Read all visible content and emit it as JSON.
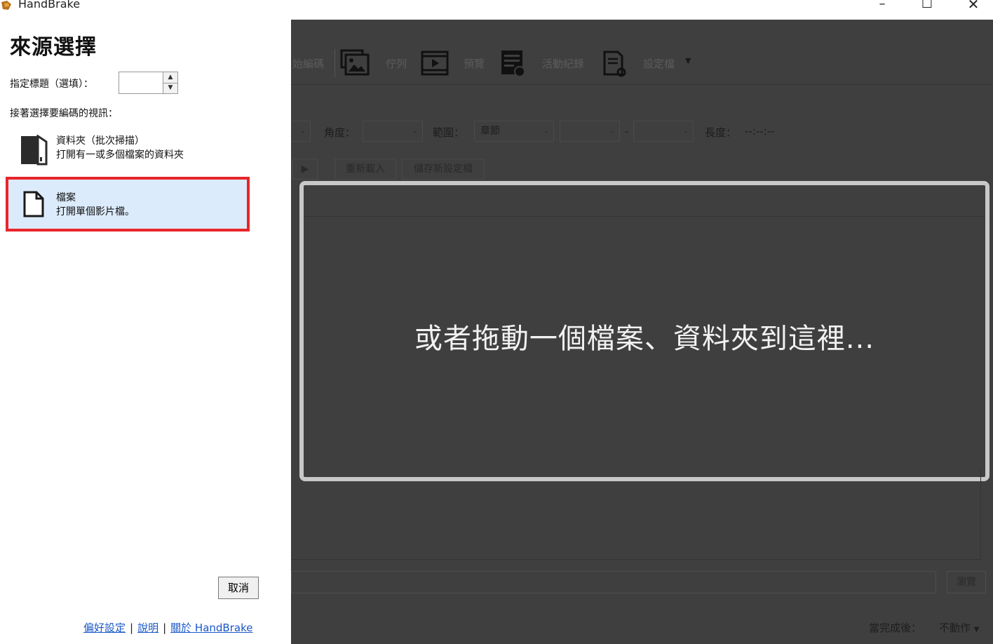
{
  "window": {
    "title": "HandBrake",
    "minimize_glyph": "–",
    "maximize_glyph": "☐",
    "close_glyph": "✕"
  },
  "source_panel": {
    "title": "來源選擇",
    "title_label": "指定標題（選填）：",
    "title_value": "",
    "choose_label": "接著選擇要編碼的視訊：",
    "options": [
      {
        "name": "資料夾（批次掃描）",
        "description": "打開有一或多個檔案的資料夾",
        "icon": "folder-icon"
      },
      {
        "name": "檔案",
        "description": "打開單個影片檔。",
        "icon": "file-icon"
      }
    ],
    "cancel_label": "取消",
    "links": [
      "偏好設定",
      "說明",
      "關於 HandBrake"
    ],
    "link_separator": "|"
  },
  "main": {
    "toolbar": {
      "items": [
        "始編碼",
        "佇列",
        "預覽",
        "活動紀錄",
        "設定檔"
      ],
      "icons": [
        "queue-images-icon",
        "preview-film-icon",
        "activity-log-icon",
        "presets-icon"
      ]
    },
    "fields": {
      "angle_label": "角度：",
      "range_label": "範圍：",
      "range_value": "章節",
      "range_dash": "-",
      "duration_label": "長度：",
      "duration_value": "--:--:--"
    },
    "buttons": {
      "reload": "重新載入",
      "save_preset": "儲存新設定檔"
    },
    "drop_text": "或者拖動一個檔案、資料夾到這裡...",
    "browse_label": "瀏覽",
    "when_done_label": "當完成後：",
    "when_done_value": "不動作"
  },
  "colors": {
    "highlight_border": "#e8252a",
    "selected_bg": "#dcebfb",
    "dim_bg": "#3f3f3f",
    "link": "#1a57c8"
  }
}
